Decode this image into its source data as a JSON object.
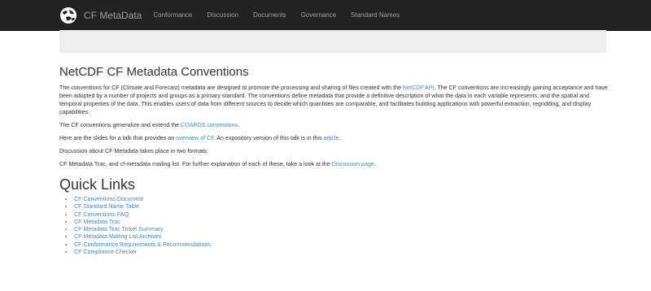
{
  "nav": {
    "brand": "CF MetaData",
    "links": [
      "Conformance",
      "Discussion",
      "Documents",
      "Governance",
      "Standard Names"
    ]
  },
  "main": {
    "title": "NetCDF CF Metadata Conventions",
    "p1": {
      "before": "The conventions for CF (Climate and Forecast) metadata are designed to promote the processing and sharing of files created with the ",
      "link": "NetCDF API",
      "after": ". The CF conventions are increasingly gaining acceptance and have been adopted by a number of projects and groups as a primary standard. The conventions define metadata that provide a definitive description of what the data in each variable represents, and the spatial and temporal properties of the data. This enables users of data from different sources to decide which quantities are comparable, and facilitates building applications with powerful extraction, regridding, and display capabilities."
    },
    "p2": {
      "before": "The CF conventions generalize and extend the ",
      "link": "COARDS conventions",
      "after": "."
    },
    "p3": {
      "before": "Here are the slides for a talk that provides an ",
      "link1": "overview of CF",
      "middle": ". An expository version of this talk is in this ",
      "link2": "article",
      "after": "."
    },
    "p4": "Discussion about CF Metadata takes place in two formats:",
    "p5": {
      "before": "CF Metadata Trac, and cf-metadata mailing list. For further explanation of each of these, take a look at the ",
      "link": "Discussion page",
      "after": "."
    },
    "quick_links_title": "Quick Links",
    "quick_links": [
      "CF Conventions Document",
      "CF Standard Name Table",
      "CF Conventions FAQ",
      "CF Metadata Trac",
      "CF Metadata Trac Ticket Summary",
      "CF Metadata Mailing List Archives",
      "CF Conformance Requirements & Recommendations",
      "CF Compliance Checker"
    ]
  },
  "colors": {
    "navbar_bg": "#222222",
    "nav_text": "#9d9d9d",
    "link": "#428bca",
    "jumbotron_bg": "#eeeeee"
  }
}
